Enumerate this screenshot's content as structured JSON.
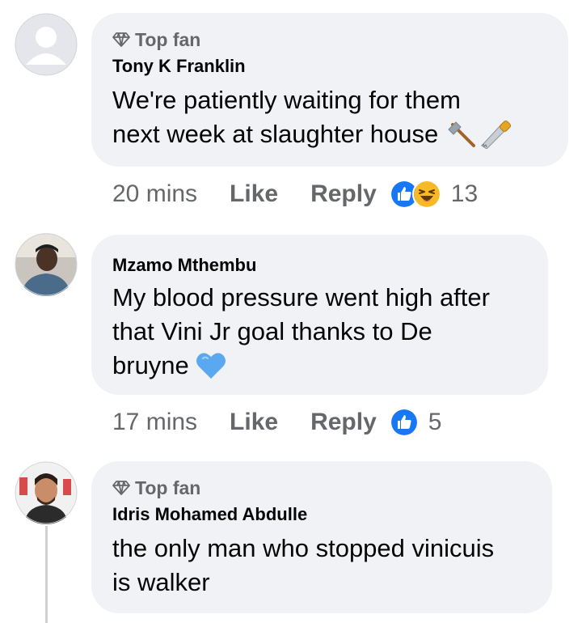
{
  "comments": [
    {
      "badge": "Top fan",
      "author": "Tony K Franklin",
      "text_lines": [
        "We're patiently waiting for them",
        "next week at slaughter house"
      ],
      "emojis": [
        "axe-icon",
        "saw-icon"
      ],
      "time": "20 mins",
      "like_label": "Like",
      "reply_label": "Reply",
      "reaction_icons": [
        "like-reaction-icon",
        "haha-reaction-icon"
      ],
      "reaction_count": "13"
    },
    {
      "badge": "",
      "author": "Mzamo Mthembu",
      "text_lines": [
        "My blood pressure went high after",
        "that Vini Jr goal thanks to De",
        "bruyne"
      ],
      "emojis": [
        "blue-heart-icon"
      ],
      "time": "17 mins",
      "like_label": "Like",
      "reply_label": "Reply",
      "reaction_icons": [
        "like-reaction-icon"
      ],
      "reaction_count": "5"
    },
    {
      "badge": "Top fan",
      "author": "Idris Mohamed Abdulle",
      "text_lines": [
        "the only man who stopped vinicuis",
        "is walker"
      ],
      "emojis": [],
      "time": "",
      "like_label": "",
      "reply_label": "",
      "reaction_icons": [],
      "reaction_count": ""
    }
  ],
  "colors": {
    "bubble": "#f0f2f5",
    "meta_text": "#65676b",
    "like_blue": "#1877f2",
    "haha_yellow": "#f7b928",
    "heart_blue": "#5aa9f0"
  }
}
